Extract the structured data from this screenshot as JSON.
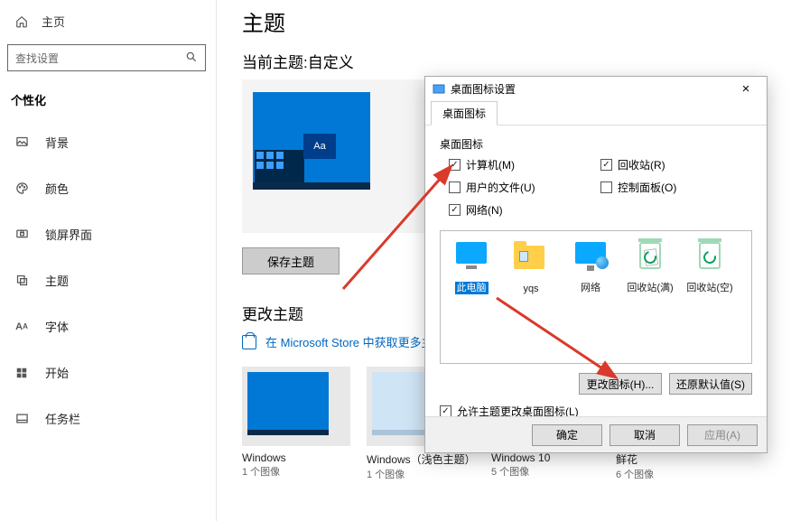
{
  "sidebar": {
    "home_label": "主页",
    "search_placeholder": "查找设置",
    "section": "个性化",
    "items": [
      {
        "icon": "image-icon",
        "label": "背景"
      },
      {
        "icon": "palette-icon",
        "label": "颜色"
      },
      {
        "icon": "lock-icon",
        "label": "锁屏界面"
      },
      {
        "icon": "theme-icon",
        "label": "主题"
      },
      {
        "icon": "font-icon",
        "label": "字体"
      },
      {
        "icon": "start-icon",
        "label": "开始"
      },
      {
        "icon": "taskbar-icon",
        "label": "任务栏"
      }
    ]
  },
  "main": {
    "title": "主题",
    "current_theme_label": "当前主题:自定义",
    "preview_sample": "Aa",
    "save_button": "保存主题",
    "change_theme_title": "更改主题",
    "store_link": "在 Microsoft Store 中获取更多主题",
    "themes": [
      {
        "name": "Windows",
        "count": "1 个图像",
        "variant": "dark"
      },
      {
        "name": "Windows（浅色主题）",
        "count": "1 个图像",
        "variant": "light"
      },
      {
        "name": "Windows 10",
        "count": "5 个图像",
        "variant": "dark"
      },
      {
        "name": "鲜花",
        "count": "6 个图像",
        "variant": "dark"
      }
    ]
  },
  "dialog": {
    "title": "桌面图标设置",
    "tab": "桌面图标",
    "frame_label": "桌面图标",
    "checks": [
      {
        "label": "计算机(M)",
        "checked": true
      },
      {
        "label": "回收站(R)",
        "checked": true
      },
      {
        "label": "用户的文件(U)",
        "checked": false
      },
      {
        "label": "控制面板(O)",
        "checked": false
      },
      {
        "label": "网络(N)",
        "checked": true
      }
    ],
    "icons": [
      {
        "label": "此电脑",
        "selected": true,
        "kind": "monitor"
      },
      {
        "label": "yqs",
        "selected": false,
        "kind": "folder"
      },
      {
        "label": "网络",
        "selected": false,
        "kind": "net"
      },
      {
        "label": "回收站(满)",
        "selected": false,
        "kind": "bin-full"
      },
      {
        "label": "回收站(空)",
        "selected": false,
        "kind": "bin-empty"
      }
    ],
    "change_icon_btn": "更改图标(H)...",
    "restore_btn": "还原默认值(S)",
    "allow_label": "允许主题更改桌面图标(L)",
    "allow_checked": true,
    "ok": "确定",
    "cancel": "取消",
    "apply": "应用(A)"
  }
}
